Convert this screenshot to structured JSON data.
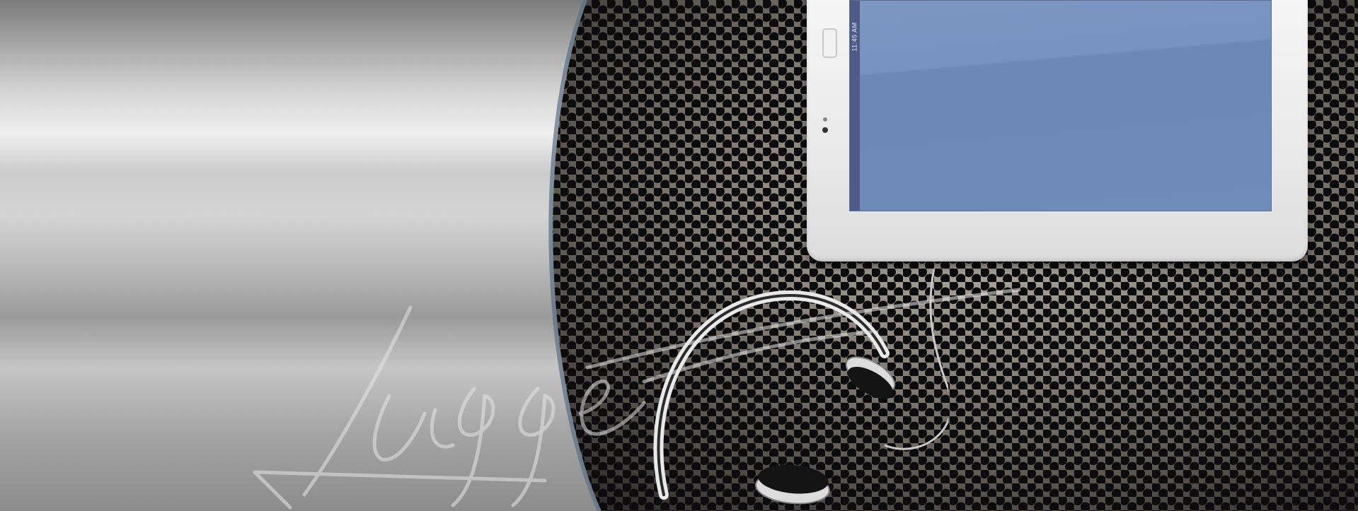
{
  "tablet": {
    "status_time": "11:45 AM",
    "screen_color": "#7692bf"
  },
  "logo": {
    "text": "Ligget"
  },
  "colors": {
    "metal_light": "#f4f4f4",
    "grille_dark": "#1b1b1b",
    "grille_light": "#b7b0a6"
  }
}
